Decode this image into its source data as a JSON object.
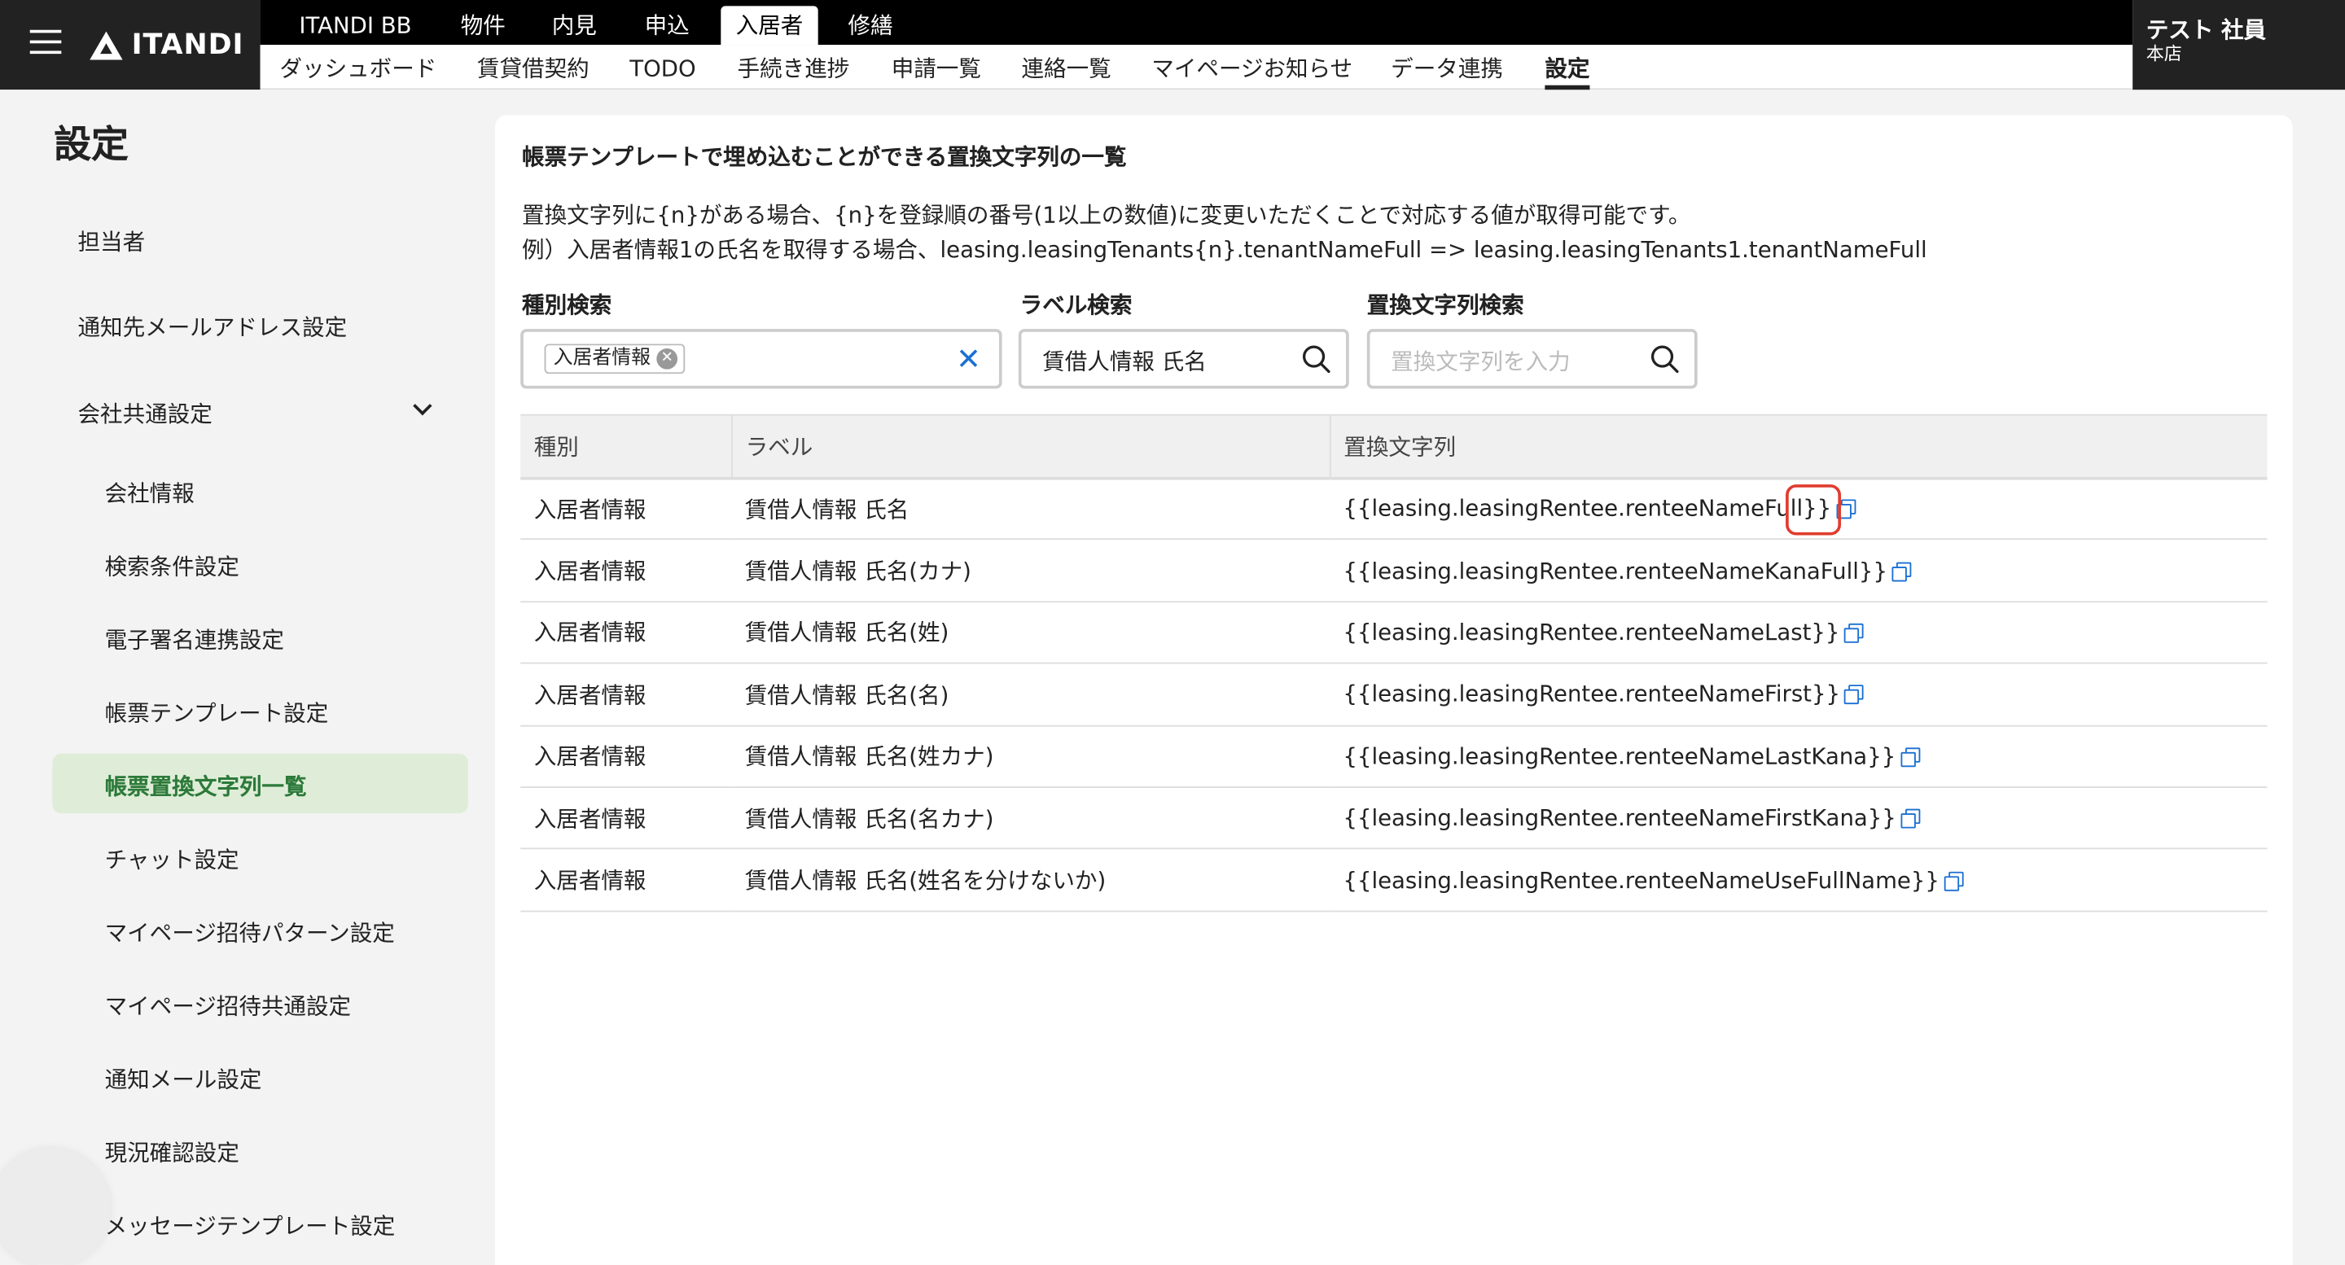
{
  "header": {
    "logo": "ITANDI",
    "top_tabs": [
      "ITANDI BB",
      "物件",
      "内見",
      "申込",
      "入居者",
      "修繕"
    ],
    "active_top_tab": "入居者",
    "sub_tabs": [
      "ダッシュボード",
      "賃貸借契約",
      "TODO",
      "手続き進捗",
      "申請一覧",
      "連絡一覧",
      "マイページお知らせ",
      "データ連携",
      "設定"
    ],
    "active_sub_tab": "設定",
    "user_name": "テスト 社員",
    "user_branch": "本店"
  },
  "sidebar": {
    "title": "設定",
    "items": [
      "担当者",
      "通知先メールアドレス設定",
      "会社共通設定"
    ],
    "sub_items": [
      "会社情報",
      "検索条件設定",
      "電子署名連携設定",
      "帳票テンプレート設定",
      "帳票置換文字列一覧",
      "チャット設定",
      "マイページ招待パターン設定",
      "マイページ招待共通設定",
      "通知メール設定",
      "現況確認設定",
      "メッセージテンプレート設定"
    ],
    "active_sub_item": "帳票置換文字列一覧"
  },
  "main": {
    "title": "帳票テンプレートで埋め込むことができる置換文字列の一覧",
    "desc_line1": "置換文字列に{n}がある場合、{n}を登録順の番号(1以上の数値)に変更いただくことで対応する値が取得可能です。",
    "desc_line2": "例）入居者情報1の氏名を取得する場合、leasing.leasingTenants{n}.tenantNameFull => leasing.leasingTenants1.tenantNameFull",
    "filters": {
      "type_label": "種別検索",
      "type_chip": "入居者情報",
      "label_label": "ラベル検索",
      "label_value": "賃借人情報 氏名",
      "replace_label": "置換文字列検索",
      "replace_placeholder": "置換文字列を入力"
    },
    "table": {
      "headers": [
        "種別",
        "ラベル",
        "置換文字列"
      ],
      "rows": [
        [
          "入居者情報",
          "賃借人情報 氏名",
          "{{leasing.leasingRentee.renteeNameFull}}"
        ],
        [
          "入居者情報",
          "賃借人情報 氏名(カナ)",
          "{{leasing.leasingRentee.renteeNameKanaFull}}"
        ],
        [
          "入居者情報",
          "賃借人情報 氏名(姓)",
          "{{leasing.leasingRentee.renteeNameLast}}"
        ],
        [
          "入居者情報",
          "賃借人情報 氏名(名)",
          "{{leasing.leasingRentee.renteeNameFirst}}"
        ],
        [
          "入居者情報",
          "賃借人情報 氏名(姓カナ)",
          "{{leasing.leasingRentee.renteeNameLastKana}}"
        ],
        [
          "入居者情報",
          "賃借人情報 氏名(名カナ)",
          "{{leasing.leasingRentee.renteeNameFirstKana}}"
        ],
        [
          "入居者情報",
          "賃借人情報 氏名(姓名を分けないか)",
          "{{leasing.leasingRentee.renteeNameUseFullName}}"
        ]
      ]
    }
  },
  "colors": {
    "accent": "#1a6fd3",
    "active_green_bg": "#dfedd8",
    "active_green_text": "#2c7a3a",
    "highlight": "#e03c2e"
  }
}
